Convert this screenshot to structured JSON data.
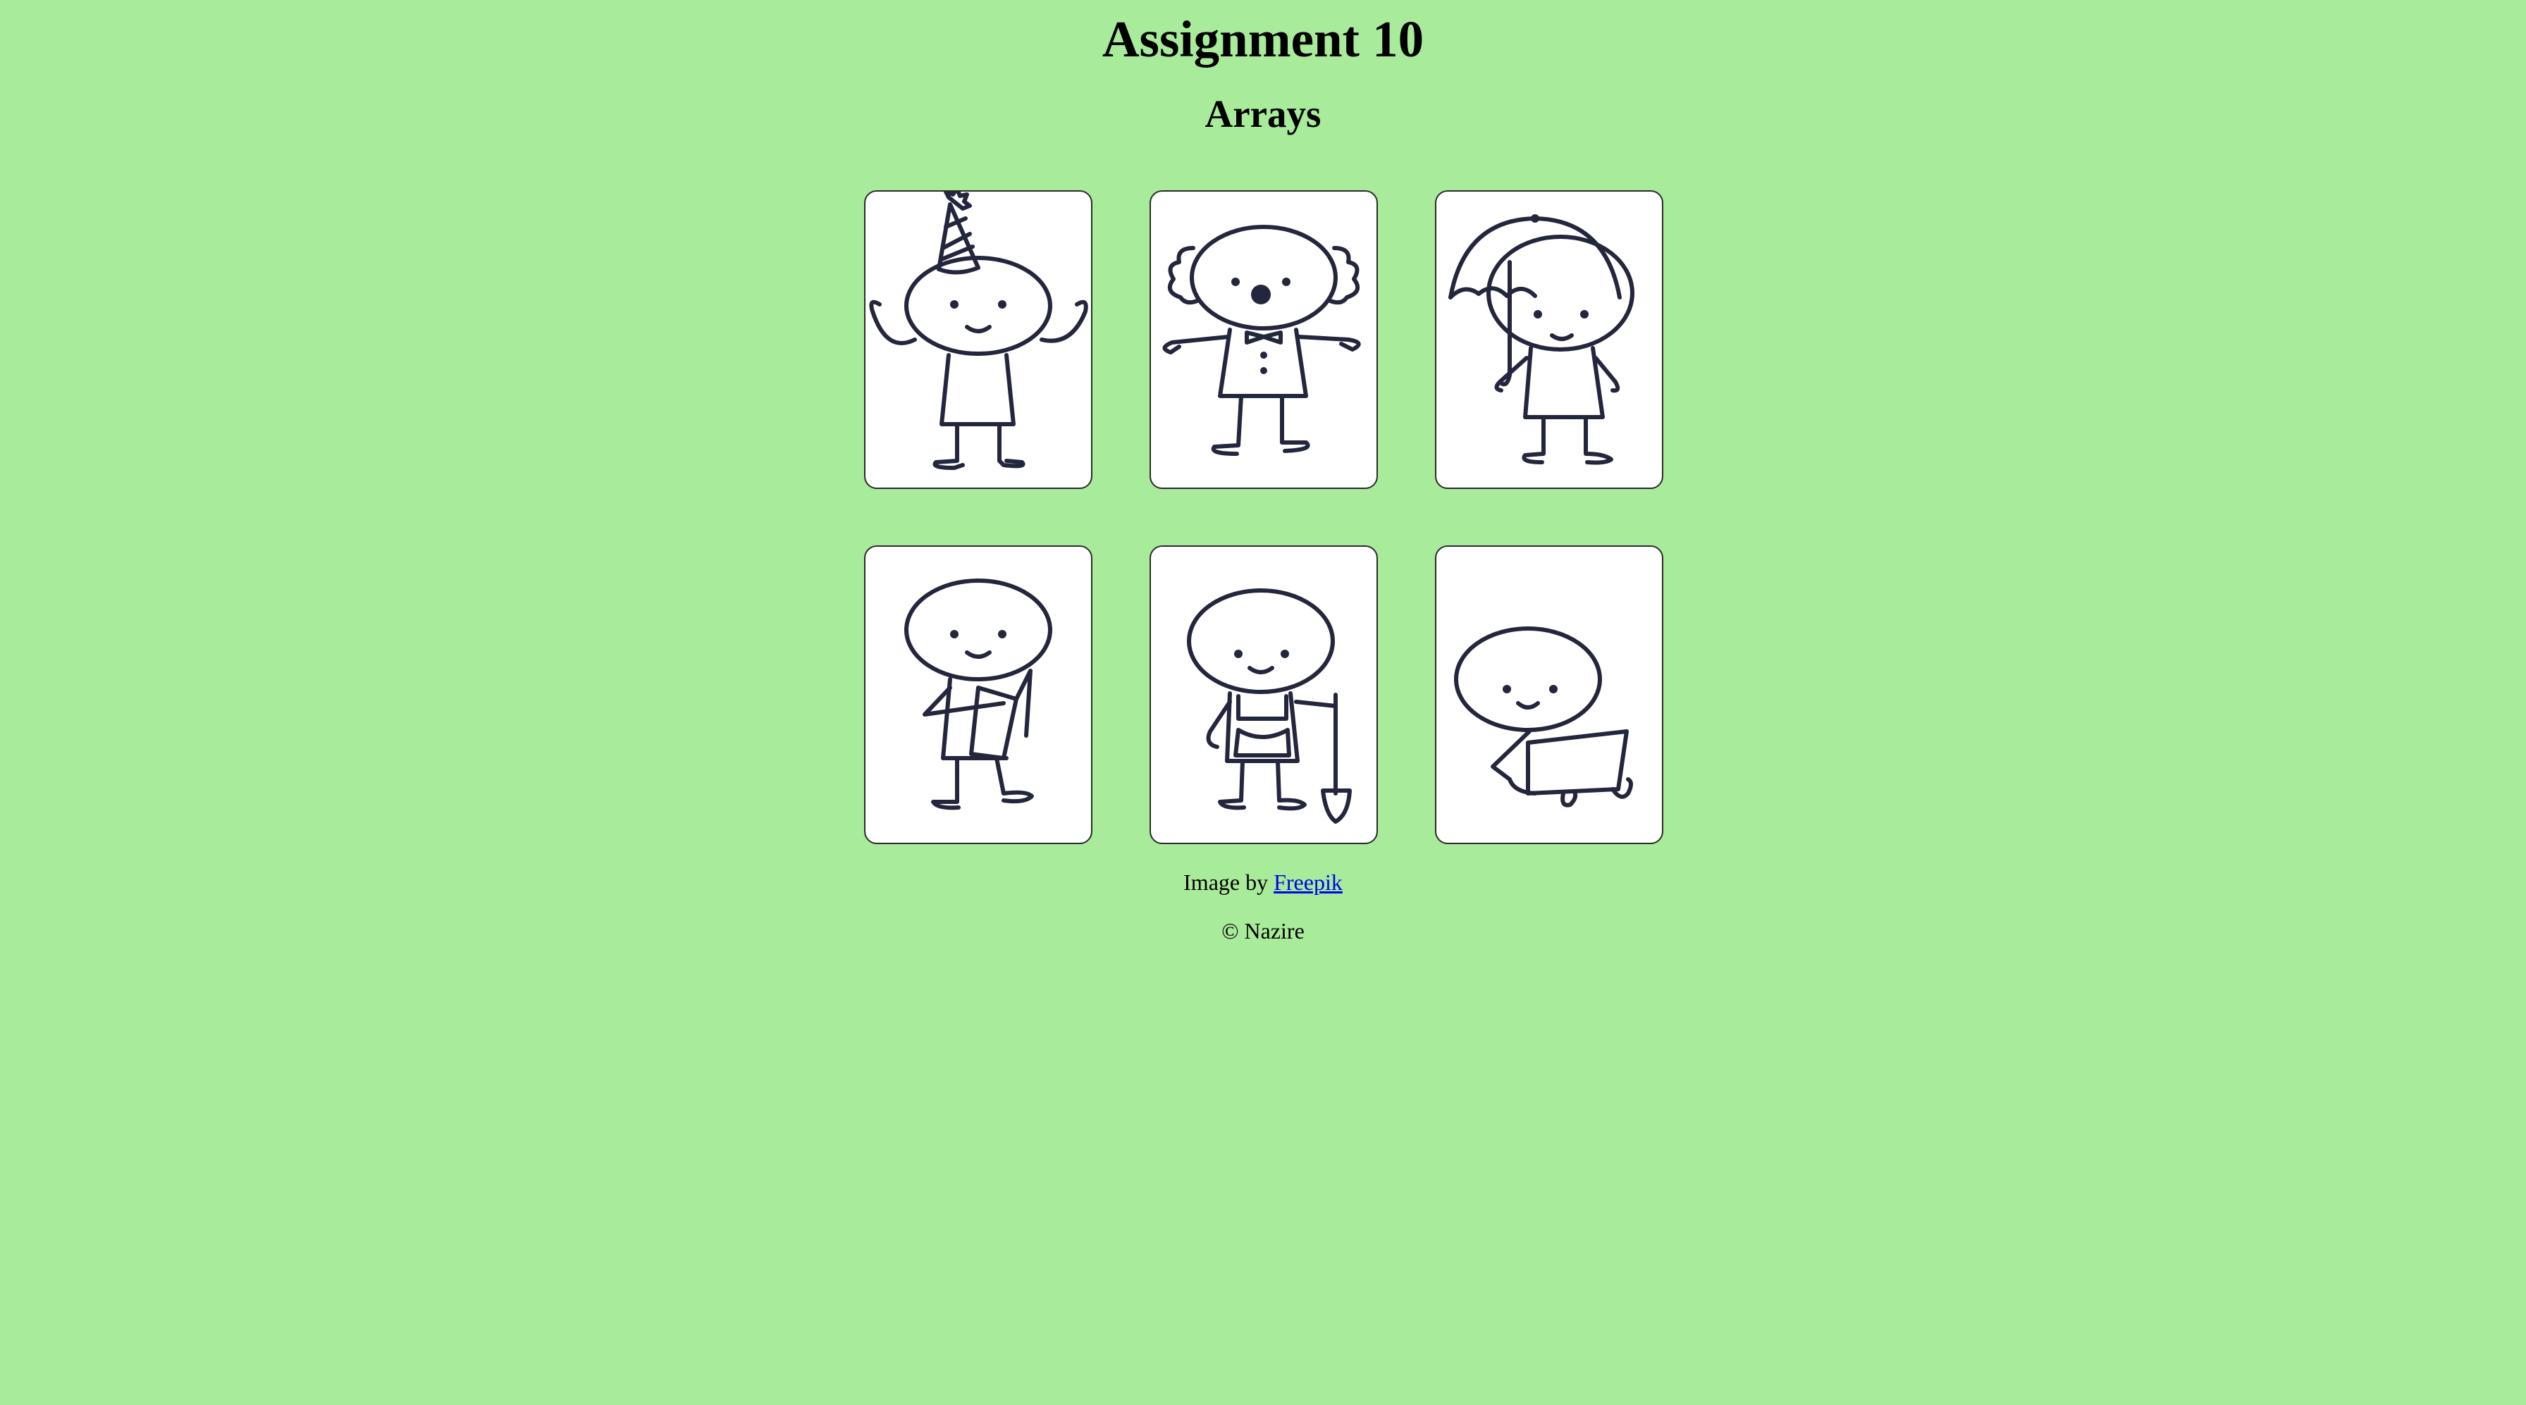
{
  "header": {
    "title": "Assignment 10",
    "subtitle": "Arrays"
  },
  "gallery": {
    "cards": [
      {
        "icon": "party-hat-figure-icon"
      },
      {
        "icon": "clown-figure-icon"
      },
      {
        "icon": "umbrella-figure-icon"
      },
      {
        "icon": "reading-figure-icon"
      },
      {
        "icon": "gardener-shovel-figure-icon"
      },
      {
        "icon": "laptop-figure-icon"
      }
    ]
  },
  "footer": {
    "credit_prefix": "Image by",
    "credit_link": "Freepik",
    "copyright": "© Nazire"
  },
  "colors": {
    "background": "#a8eb9a",
    "card": "#ffffff",
    "ink": "#23263d",
    "link": "#0000ee"
  }
}
